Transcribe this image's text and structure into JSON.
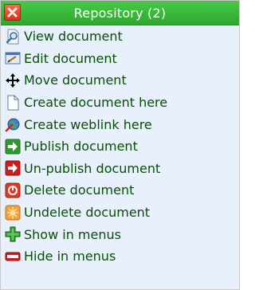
{
  "menu": {
    "title": "Repository (2)",
    "items": [
      {
        "label": "View document",
        "icon": "magnifier-icon"
      },
      {
        "label": "Edit document",
        "icon": "edit-icon"
      },
      {
        "label": "Move document",
        "icon": "move-arrows-icon"
      },
      {
        "label": "Create document here",
        "icon": "blank-document-icon"
      },
      {
        "label": "Create weblink here",
        "icon": "globe-link-icon"
      },
      {
        "label": "Publish document",
        "icon": "publish-arrow-icon"
      },
      {
        "label": "Un-publish document",
        "icon": "unpublish-arrow-icon"
      },
      {
        "label": "Delete document",
        "icon": "delete-icon"
      },
      {
        "label": "Undelete document",
        "icon": "undelete-icon"
      },
      {
        "label": "Show in menus",
        "icon": "plus-icon"
      },
      {
        "label": "Hide in menus",
        "icon": "minus-icon"
      }
    ]
  },
  "colors": {
    "header": "#2ea82e",
    "background": "#e8f0fb",
    "text": "#0a4e0a",
    "close": "#e02d1a"
  }
}
